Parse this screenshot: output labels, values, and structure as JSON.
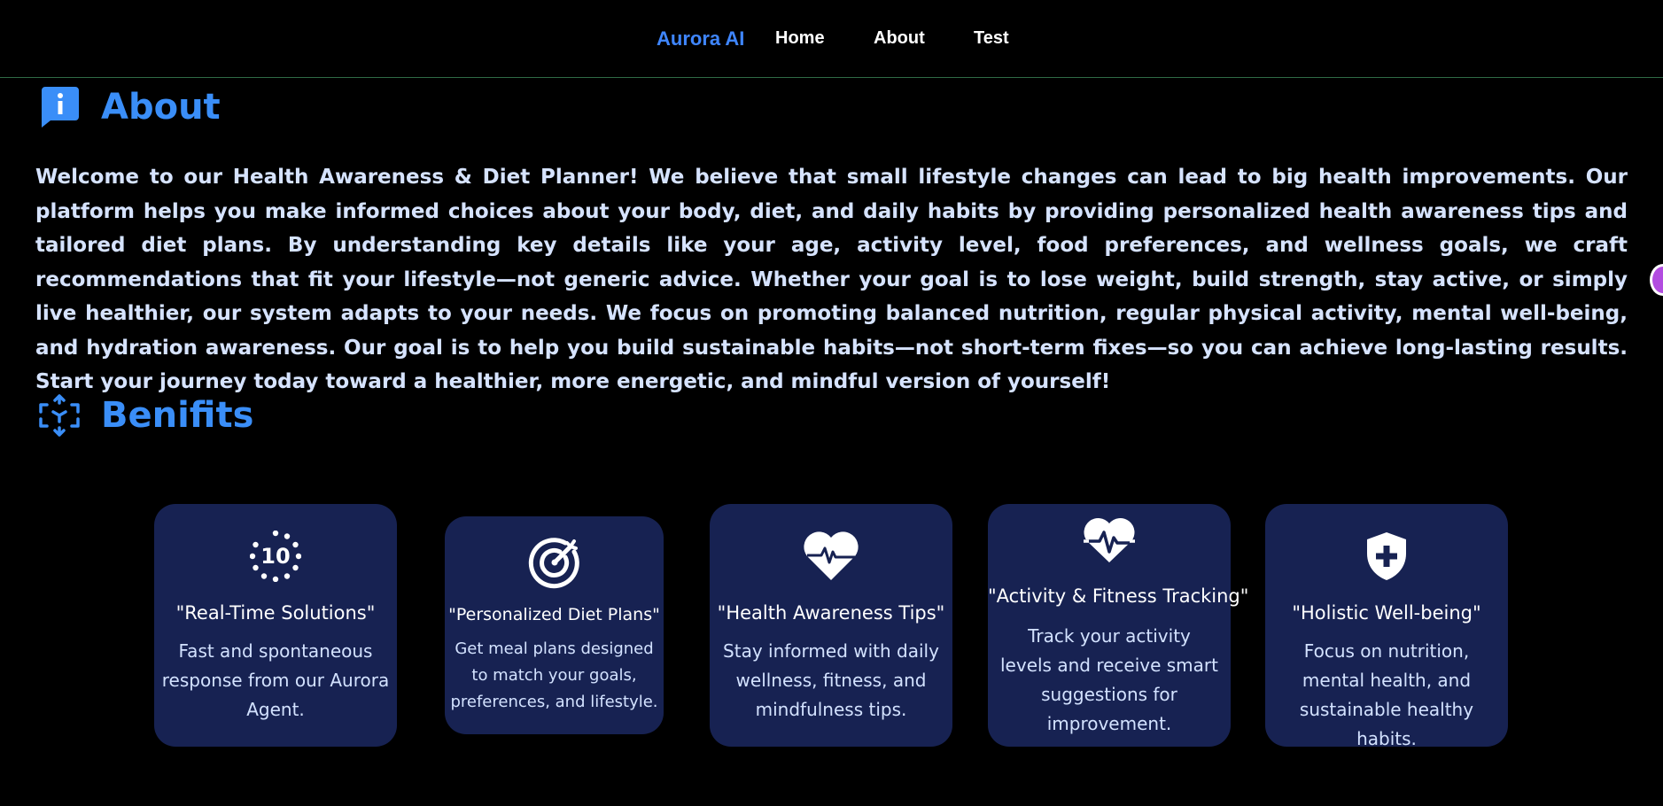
{
  "nav": {
    "brand": "Aurora AI",
    "links": [
      "Home",
      "About",
      "Test"
    ]
  },
  "about": {
    "heading": "About",
    "icon": "info-chat-icon",
    "body": "Welcome to our Health Awareness & Diet Planner! We believe that small lifestyle changes can lead to big health improvements. Our platform helps you make informed choices about your body, diet, and daily habits by providing personalized health awareness tips and tailored diet plans. By understanding key details like your age, activity level, food preferences, and wellness goals, we craft recommendations that fit your lifestyle—not generic advice. Whether your goal is to lose weight, build strength, stay active, or simply live healthier, our system adapts to your needs. We focus on promoting balanced nutrition, regular physical activity, mental well-being, and hydration awareness. Our goal is to help you build sustainable habits—not short-term fixes—so you can achieve long-lasting results. Start your journey today toward a healthier, more energetic, and mindful version of yourself!"
  },
  "benefits": {
    "heading": "Benifits",
    "icon": "cube-expand-icon",
    "cards": [
      {
        "icon": "timer-10-icon",
        "title": "\"Real-Time Solutions\"",
        "desc": "Fast and spontaneous response from our Aurora Agent."
      },
      {
        "icon": "target-icon",
        "title": "\"Personalized Diet Plans\"",
        "desc": "Get meal plans designed to match your goals, preferences, and lifestyle."
      },
      {
        "icon": "heart-pulse-icon",
        "title": "\"Health Awareness Tips\"",
        "desc": "Stay informed with daily wellness, fitness, and mindfulness tips."
      },
      {
        "icon": "heartbeat-icon",
        "title": "\"Activity & Fitness Tracking\"",
        "desc": "Track your activity levels and receive smart suggestions for improvement."
      },
      {
        "icon": "shield-plus-icon",
        "title": "\"Holistic Well-being\"",
        "desc": "Focus on nutrition, mental health, and sustainable healthy habits."
      }
    ]
  },
  "colors": {
    "background": "#000000",
    "brand": "#3f86ff",
    "heading": "#3a8ef8",
    "card": "#172252",
    "divider": "#2f6b45"
  }
}
